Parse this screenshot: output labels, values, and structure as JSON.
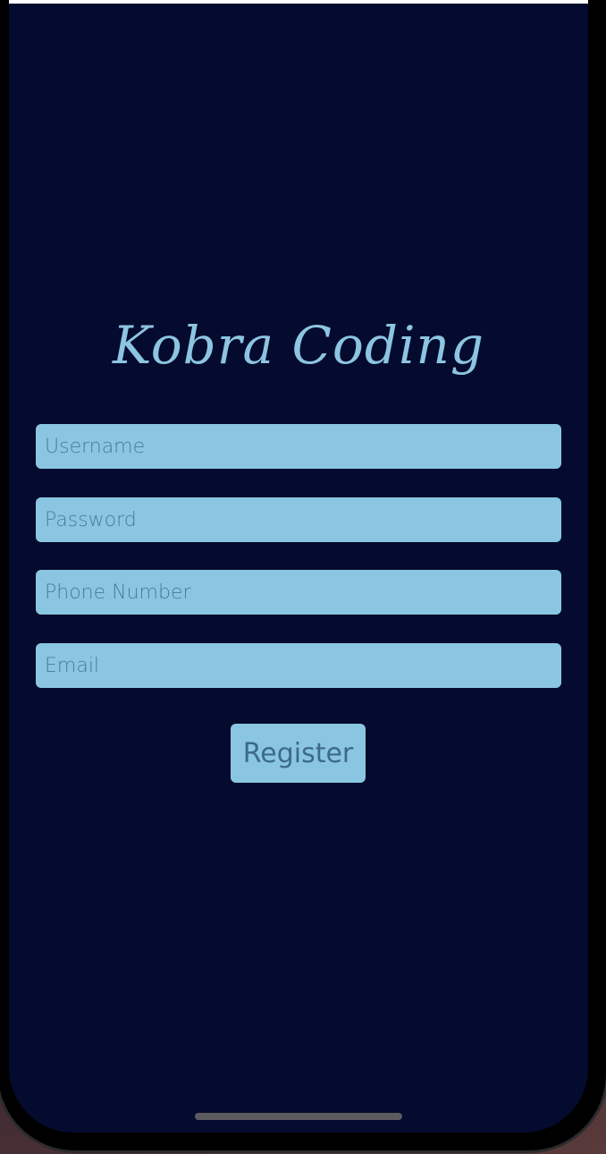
{
  "app": {
    "title": "Kobra Coding"
  },
  "form": {
    "username_placeholder": "Username",
    "password_placeholder": "Password",
    "phone_placeholder": "Phone Number",
    "email_placeholder": "Email",
    "register_label": "Register"
  },
  "colors": {
    "background": "#050b2e",
    "accent": "#8ac6e2",
    "title": "#8cc5e1"
  }
}
